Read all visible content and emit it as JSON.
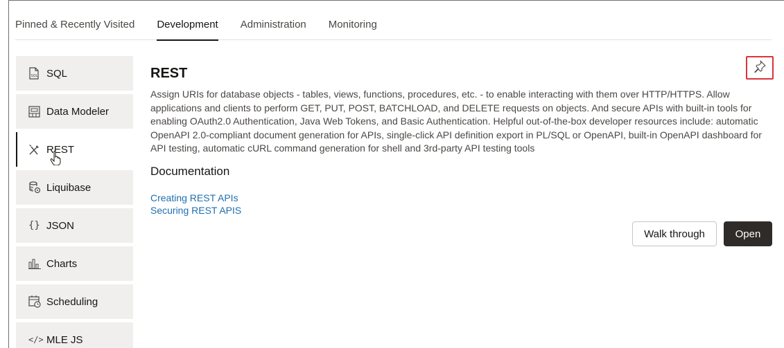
{
  "tabs": [
    {
      "label": "Pinned & Recently Visited"
    },
    {
      "label": "Development",
      "active": true
    },
    {
      "label": "Administration"
    },
    {
      "label": "Monitoring"
    }
  ],
  "sidebar": {
    "items": [
      {
        "label": "SQL",
        "icon": "sql-file-icon"
      },
      {
        "label": "Data Modeler",
        "icon": "data-modeler-icon"
      },
      {
        "label": "REST",
        "icon": "rest-tools-icon",
        "active": true
      },
      {
        "label": "Liquibase",
        "icon": "liquibase-icon"
      },
      {
        "label": "JSON",
        "icon": "json-braces-icon"
      },
      {
        "label": "Charts",
        "icon": "charts-icon"
      },
      {
        "label": "Scheduling",
        "icon": "scheduling-icon"
      },
      {
        "label": "MLE JS",
        "icon": "code-icon"
      }
    ]
  },
  "main": {
    "title": "REST",
    "description": "Assign URIs for database objects - tables, views, functions, procedures, etc. - to enable interacting with them over HTTP/HTTPS. Allow applications and clients to perform GET, PUT, POST, BATCHLOAD, and DELETE requests on objects. And secure APIs with built-in tools for enabling OAuth2.0 Authentication, Java Web Tokens, and Basic Authentication. Helpful out-of-the-box developer resources include: automatic OpenAPI 2.0-compliant document generation for APIs, single-click API definition export in PL/SQL or OpenAPI, built-in OpenAPI dashboard for API testing, automatic cURL command generation for shell and 3rd-party API testing tools",
    "documentation_heading": "Documentation",
    "links": [
      "Creating REST APIs",
      "Securing REST APIS"
    ]
  },
  "buttons": {
    "walk_through": "Walk through",
    "open": "Open"
  },
  "colors": {
    "link": "#1e6fb0",
    "highlight_box": "#d9333a",
    "primary_button": "#2e2b28",
    "sidebar_bg": "#f1efed"
  }
}
